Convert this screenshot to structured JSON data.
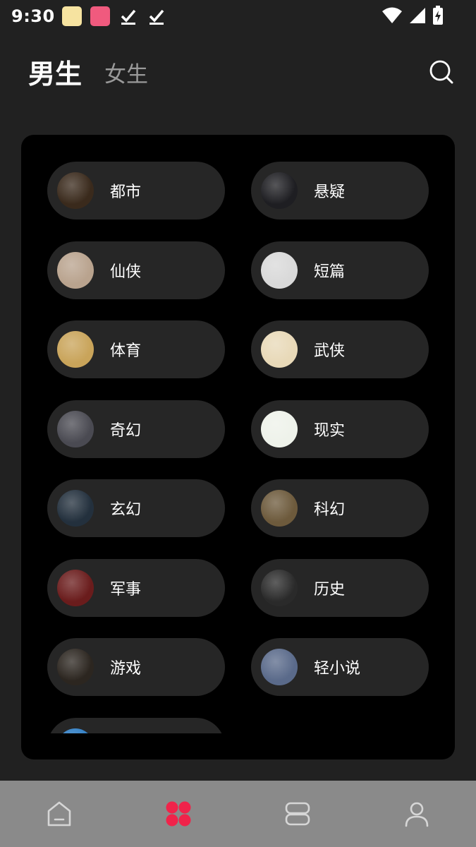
{
  "status_bar": {
    "time": "9:30",
    "icons": [
      "app-notification-icon",
      "app-notification-icon",
      "download-done-icon",
      "download-done-icon",
      "wifi-icon",
      "signal-icon",
      "battery-charging-icon"
    ]
  },
  "header": {
    "tab_male": "男生",
    "tab_female": "女生",
    "search_icon": "search-icon"
  },
  "categories": [
    {
      "label": "都市",
      "color": "#3a2a1c"
    },
    {
      "label": "悬疑",
      "color": "#1e1e22"
    },
    {
      "label": "仙侠",
      "color": "#b9a38e"
    },
    {
      "label": "短篇",
      "color": "#d9d9d9"
    },
    {
      "label": "体育",
      "color": "#c9a45a"
    },
    {
      "label": "武侠",
      "color": "#e8d9b8"
    },
    {
      "label": "奇幻",
      "color": "#4a4a52"
    },
    {
      "label": "现实",
      "color": "#eef2ea"
    },
    {
      "label": "玄幻",
      "color": "#23303d"
    },
    {
      "label": "科幻",
      "color": "#6d5a3c"
    },
    {
      "label": "军事",
      "color": "#6a1c1c"
    },
    {
      "label": "历史",
      "color": "#2a2a2a"
    },
    {
      "label": "游戏",
      "color": "#2c2620"
    },
    {
      "label": "轻小说",
      "color": "#5a6a8a"
    },
    {
      "label": "",
      "color": "#2e7dc4"
    }
  ],
  "bottom_nav": {
    "items": [
      {
        "name": "home-icon",
        "active": false
      },
      {
        "name": "category-icon",
        "active": true
      },
      {
        "name": "bookshelf-icon",
        "active": false
      },
      {
        "name": "profile-icon",
        "active": false
      }
    ],
    "accent_color": "#f0234a",
    "inactive_color": "#d6d6d6"
  }
}
